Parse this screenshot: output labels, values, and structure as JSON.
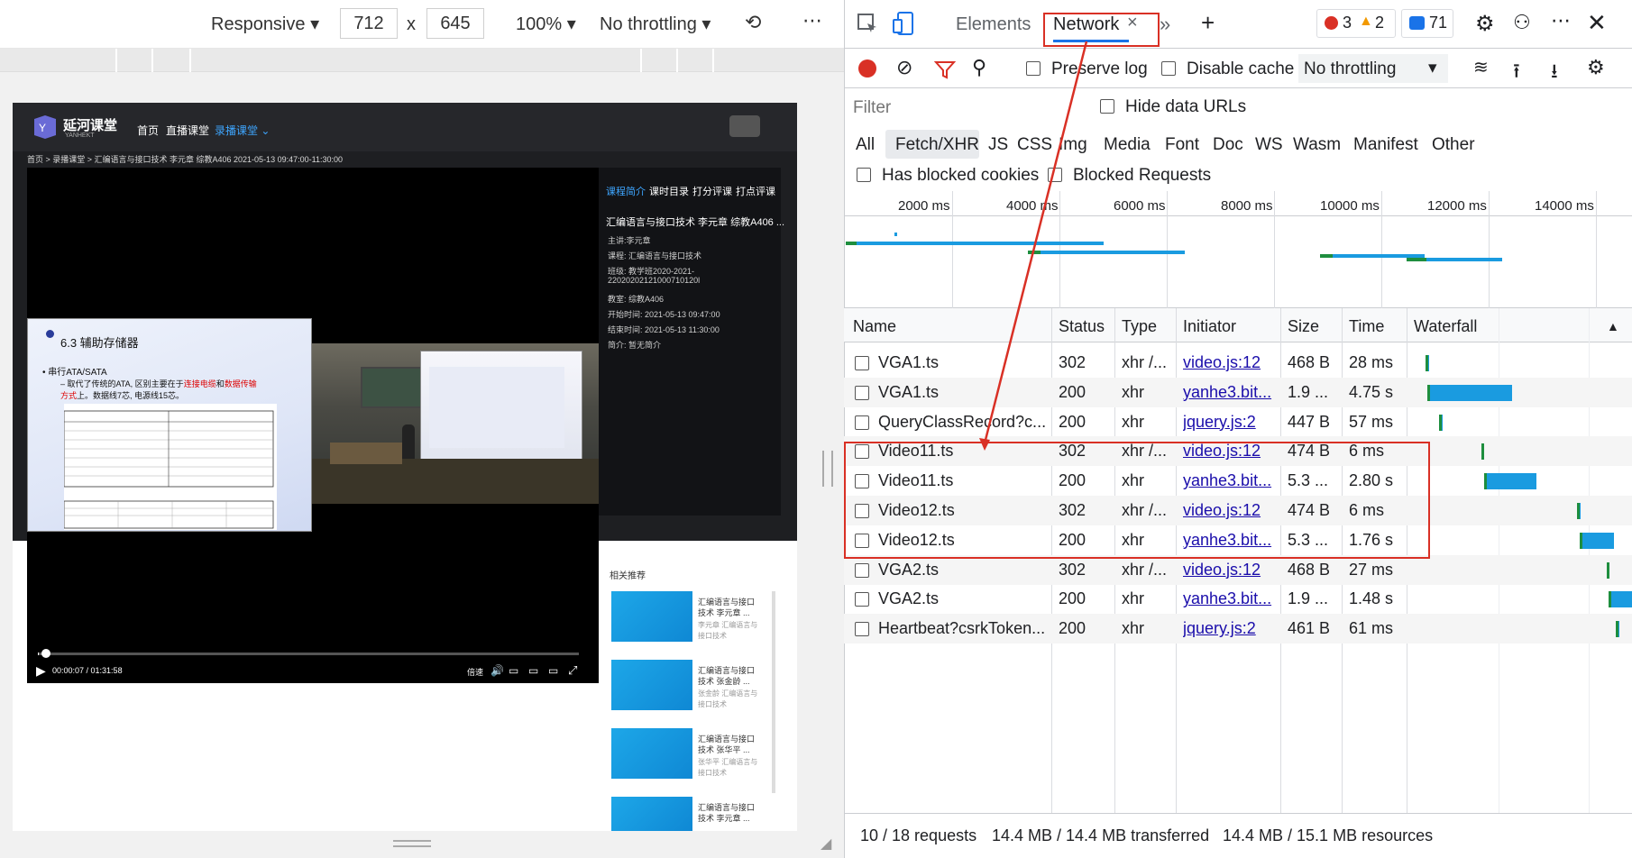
{
  "device_toolbar": {
    "mode": "Responsive",
    "width": "712",
    "times": "x",
    "height": "645",
    "zoom": "100%",
    "throttle": "No throttling"
  },
  "site": {
    "logo_text": "延河课堂",
    "logo_sub": "YANHEKT",
    "nav": [
      "首页",
      "直播课堂",
      "录播课堂"
    ],
    "breadcrumb": "首页 > 录播课堂 > 汇编语言与接口技术 李元章 综教A406 2021-05-13 09:47:00-11:30:00",
    "tabs": [
      "课程简介",
      "课时目录",
      "打分评课",
      "打点评课"
    ],
    "course_title": "汇编语言与接口技术 李元章 综教A406 ...",
    "info": [
      "主讲:李元章",
      "课程: 汇编语言与接口技术",
      "班级: 教学班2020-2021-",
      "22020202121000710120l",
      "教室: 综教A406",
      "开始时间: 2021-05-13 09:47:00",
      "结束时间: 2021-05-13 11:30:00",
      "简介: 暂无简介"
    ],
    "slide": {
      "title": "6.3 辅助存储器",
      "bullet1": "串行ATA/SATA",
      "bullet2a": "– 取代了传统的ATA, 区别主要在于",
      "bullet2b": "连接电缆",
      "bullet2c": "和",
      "bullet2d": "数据传输",
      "bullet3a": "方式",
      "bullet3b": "上。数据线7芯, 电源线15芯。"
    },
    "player": {
      "time": "00:00:07 / 01:31:58",
      "speed": "倍速",
      "progress": 0.0013
    },
    "rec_title": "相关推荐",
    "rec_items": [
      {
        "title": "汇编语言与接口技术 李元章 ...",
        "sub": "李元章 汇编语言与接口技术"
      },
      {
        "title": "汇编语言与接口技术 张金龄 ...",
        "sub": "张金龄 汇编语言与接口技术"
      },
      {
        "title": "汇编语言与接口技术 张华平 ...",
        "sub": "张华平 汇编语言与接口技术"
      },
      {
        "title": "汇编语言与接口技术 李元章 ...",
        "sub": ""
      }
    ]
  },
  "devtools": {
    "tabs": [
      "Elements",
      "Network"
    ],
    "errors": "3",
    "warnings": "2",
    "messages": "71",
    "preserve_log": "Preserve log",
    "disable_cache": "Disable cache",
    "throttle": "No throttling",
    "filter_placeholder": "Filter",
    "hide_data_urls": "Hide data URLs",
    "types": [
      "All",
      "Fetch/XHR",
      "JS",
      "CSS",
      "Img",
      "Media",
      "Font",
      "Doc",
      "WS",
      "Wasm",
      "Manifest",
      "Other"
    ],
    "has_blocked_cookies": "Has blocked cookies",
    "blocked_requests": "Blocked Requests",
    "overview_ticks": [
      "2000 ms",
      "4000 ms",
      "6000 ms",
      "8000 ms",
      "10000 ms",
      "12000 ms",
      "14000 ms"
    ],
    "columns": [
      "Name",
      "Status",
      "Type",
      "Initiator",
      "Size",
      "Time",
      "Waterfall"
    ],
    "rows": [
      {
        "name": "VGA1.ts",
        "status": "302",
        "type": "xhr /...",
        "initiator": "video.js:12",
        "size": "468 B",
        "time": "28 ms"
      },
      {
        "name": "VGA1.ts",
        "status": "200",
        "type": "xhr",
        "initiator": "yanhe3.bit...",
        "size": "1.9 ...",
        "time": "4.75 s"
      },
      {
        "name": "QueryClassRecord?c...",
        "status": "200",
        "type": "xhr",
        "initiator": "jquery.js:2",
        "size": "447 B",
        "time": "57 ms"
      },
      {
        "name": "Video11.ts",
        "status": "302",
        "type": "xhr /...",
        "initiator": "video.js:12",
        "size": "474 B",
        "time": "6 ms"
      },
      {
        "name": "Video11.ts",
        "status": "200",
        "type": "xhr",
        "initiator": "yanhe3.bit...",
        "size": "5.3 ...",
        "time": "2.80 s"
      },
      {
        "name": "Video12.ts",
        "status": "302",
        "type": "xhr /...",
        "initiator": "video.js:12",
        "size": "474 B",
        "time": "6 ms"
      },
      {
        "name": "Video12.ts",
        "status": "200",
        "type": "xhr",
        "initiator": "yanhe3.bit...",
        "size": "5.3 ...",
        "time": "1.76 s"
      },
      {
        "name": "VGA2.ts",
        "status": "302",
        "type": "xhr /...",
        "initiator": "video.js:12",
        "size": "468 B",
        "time": "27 ms"
      },
      {
        "name": "VGA2.ts",
        "status": "200",
        "type": "xhr",
        "initiator": "yanhe3.bit...",
        "size": "1.9 ...",
        "time": "1.48 s"
      },
      {
        "name": "Heartbeat?csrkToken...",
        "status": "200",
        "type": "xhr",
        "initiator": "jquery.js:2",
        "size": "461 B",
        "time": "61 ms"
      }
    ],
    "summary": [
      "10 / 18 requests",
      "14.4 MB / 14.4 MB transferred",
      "14.4 MB / 15.1 MB resources"
    ]
  },
  "colors": {
    "accent": "#1a73e8",
    "record": "#d93025",
    "highlight": "#d93025",
    "waterfall": "#1a9be0",
    "waterfall_wait": "#1e8e3e"
  }
}
